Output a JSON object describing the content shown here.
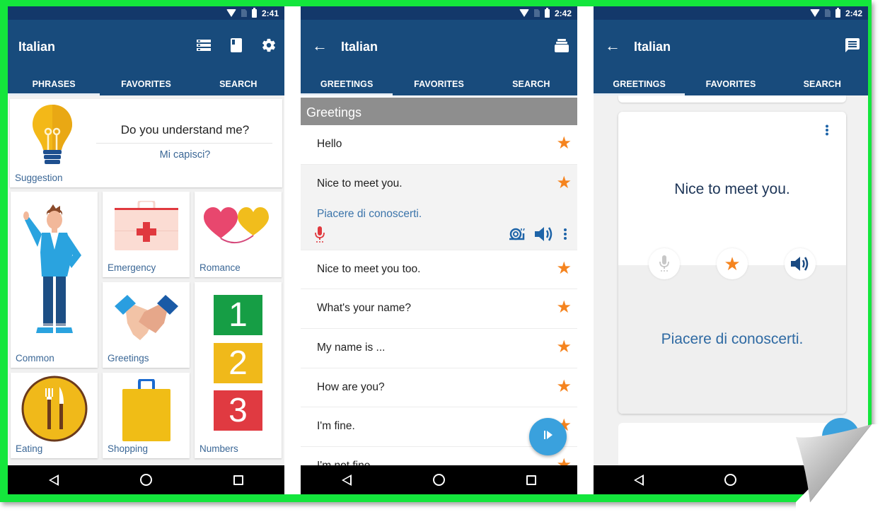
{
  "colors": {
    "appbar": "#184b7c",
    "statusbar": "#13386a",
    "frame": "#14e63c",
    "accent_blue": "#3b6796",
    "star": "#f5841f",
    "fab": "#3aa1dd"
  },
  "screens": [
    {
      "status_time": "2:41",
      "title": "Italian",
      "actions": [
        "list-icon",
        "book-icon",
        "settings-icon"
      ],
      "tabs": [
        {
          "label": "PHRASES",
          "active": true
        },
        {
          "label": "FAVORITES",
          "active": false
        },
        {
          "label": "SEARCH",
          "active": false
        }
      ],
      "suggestion": {
        "label": "Suggestion",
        "phrase": "Do you understand me?",
        "translation": "Mi capisci?"
      },
      "categories": [
        {
          "label": "Common",
          "icon": "person-icon"
        },
        {
          "label": "Emergency",
          "icon": "first-aid-kit-icon"
        },
        {
          "label": "Romance",
          "icon": "hearts-icon"
        },
        {
          "label": "Greetings",
          "icon": "handshake-icon"
        },
        {
          "label": "Numbers",
          "icon": "numbers-icon",
          "digits": [
            "1",
            "2",
            "3"
          ]
        },
        {
          "label": "Eating",
          "icon": "fork-knife-icon"
        },
        {
          "label": "Shopping",
          "icon": "shopping-bag-icon"
        }
      ]
    },
    {
      "status_time": "2:42",
      "title": "Italian",
      "actions": [
        "flashcards-icon"
      ],
      "tabs": [
        {
          "label": "GREETINGS",
          "active": true
        },
        {
          "label": "FAVORITES",
          "active": false
        },
        {
          "label": "SEARCH",
          "active": false
        }
      ],
      "section_header": "Greetings",
      "phrases": [
        {
          "text": "Hello",
          "favorite": true
        },
        {
          "text": "Nice to meet you.",
          "favorite": true,
          "translation": "Piacere di conoscerti.",
          "expanded": true
        },
        {
          "text": "Nice to meet you too.",
          "favorite": true
        },
        {
          "text": "What's your name?",
          "favorite": true
        },
        {
          "text": "My name is ...",
          "favorite": true
        },
        {
          "text": "How are you?",
          "favorite": true
        },
        {
          "text": "I'm fine.",
          "favorite": true
        },
        {
          "text": "I'm not fine.",
          "favorite": true
        }
      ]
    },
    {
      "status_time": "2:42",
      "title": "Italian",
      "actions": [
        "message-icon"
      ],
      "tabs": [
        {
          "label": "GREETINGS",
          "active": true
        },
        {
          "label": "FAVORITES",
          "active": false
        },
        {
          "label": "SEARCH",
          "active": false
        }
      ],
      "flashcard": {
        "phrase": "Nice to meet you.",
        "translation": "Piacere di conoscerti.",
        "favorite": true
      }
    }
  ]
}
